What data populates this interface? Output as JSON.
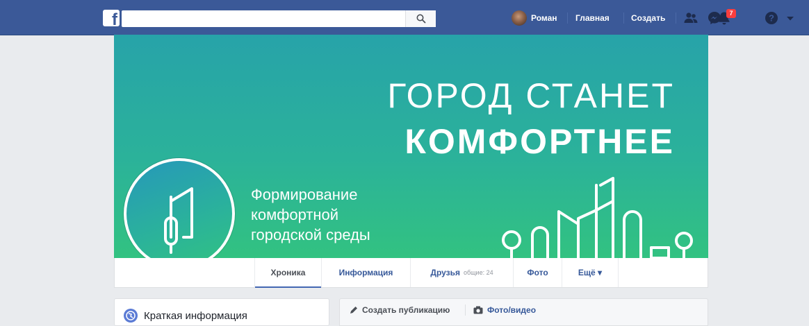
{
  "topbar": {
    "logo": "f",
    "search": {
      "value": "",
      "placeholder": ""
    },
    "user_name": "Роман",
    "home_label": "Главная",
    "create_label": "Создать",
    "notifications_count": "7",
    "icons": [
      "search-icon",
      "friend-requests-icon",
      "messenger-icon",
      "notifications-icon",
      "help-icon",
      "account-menu-icon"
    ]
  },
  "cover": {
    "headline_line1": "ГОРОД СТАНЕТ",
    "headline_line2": "КОМФОРТНЕЕ",
    "subtitle_lines": [
      "Формирование",
      "комфортной",
      "городской среды"
    ]
  },
  "tabs": {
    "timeline": "Хроника",
    "about": "Информация",
    "friends": "Друзья",
    "friends_mutual": "общие: 24",
    "photos": "Фото",
    "more": "Ещё ▾"
  },
  "intro_card": {
    "title": "Краткая информация"
  },
  "composer": {
    "create_post": "Создать публикацию",
    "photo_video": "Фото/видео"
  },
  "colors": {
    "topbar": "#3b5998",
    "link": "#365899",
    "cover_top": "#27a3a9",
    "cover_bottom": "#32c281",
    "badge": "#fa3e3e"
  }
}
